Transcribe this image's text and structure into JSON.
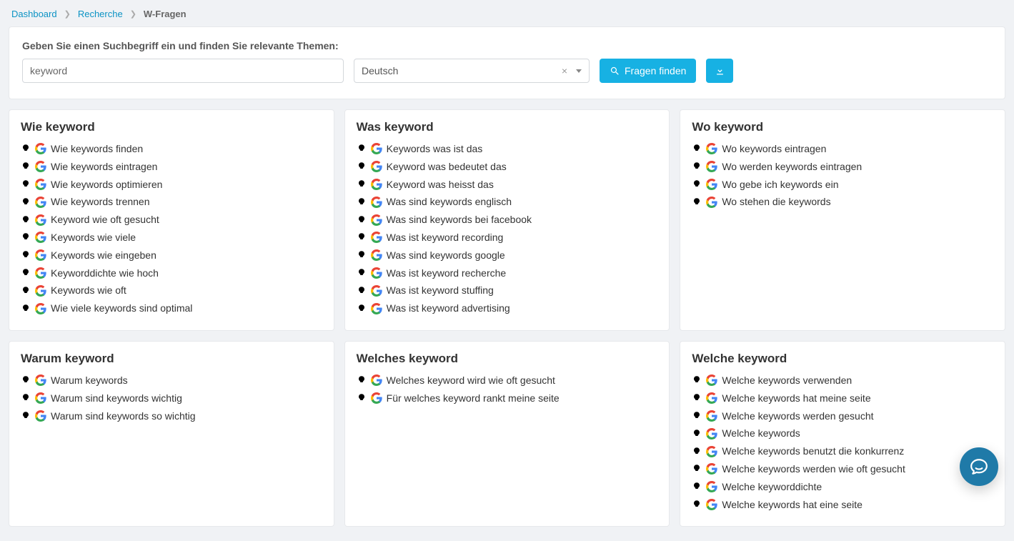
{
  "breadcrumb": {
    "dashboard": "Dashboard",
    "recherche": "Recherche",
    "current": "W-Fragen"
  },
  "search": {
    "prompt": "Geben Sie einen Suchbegriff ein und finden Sie relevante Themen:",
    "keyword_value": "keyword",
    "language_value": "Deutsch",
    "find_label": "Fragen finden"
  },
  "cards": [
    {
      "title": "Wie keyword",
      "items": [
        "Wie keywords finden",
        "Wie keywords eintragen",
        "Wie keywords optimieren",
        "Wie keywords trennen",
        "Keyword wie oft gesucht",
        "Keywords wie viele",
        "Keywords wie eingeben",
        "Keyworddichte wie hoch",
        "Keywords wie oft",
        "Wie viele keywords sind optimal"
      ]
    },
    {
      "title": "Was keyword",
      "items": [
        "Keywords was ist das",
        "Keyword was bedeutet das",
        "Keyword was heisst das",
        "Was sind keywords englisch",
        "Was sind keywords bei facebook",
        "Was ist keyword recording",
        "Was sind keywords google",
        "Was ist keyword recherche",
        "Was ist keyword stuffing",
        "Was ist keyword advertising"
      ]
    },
    {
      "title": "Wo keyword",
      "items": [
        "Wo keywords eintragen",
        "Wo werden keywords eintragen",
        "Wo gebe ich keywords ein",
        "Wo stehen die keywords"
      ]
    },
    {
      "title": "Warum keyword",
      "items": [
        "Warum keywords",
        "Warum sind keywords wichtig",
        "Warum sind keywords so wichtig"
      ]
    },
    {
      "title": "Welches keyword",
      "items": [
        "Welches keyword wird wie oft gesucht",
        "Für welches keyword rankt meine seite"
      ]
    },
    {
      "title": "Welche keyword",
      "items": [
        "Welche keywords verwenden",
        "Welche keywords hat meine seite",
        "Welche keywords werden gesucht",
        "Welche keywords",
        "Welche keywords benutzt die konkurrenz",
        "Welche keywords werden wie oft gesucht",
        "Welche keyworddichte",
        "Welche keywords hat eine seite"
      ]
    }
  ]
}
